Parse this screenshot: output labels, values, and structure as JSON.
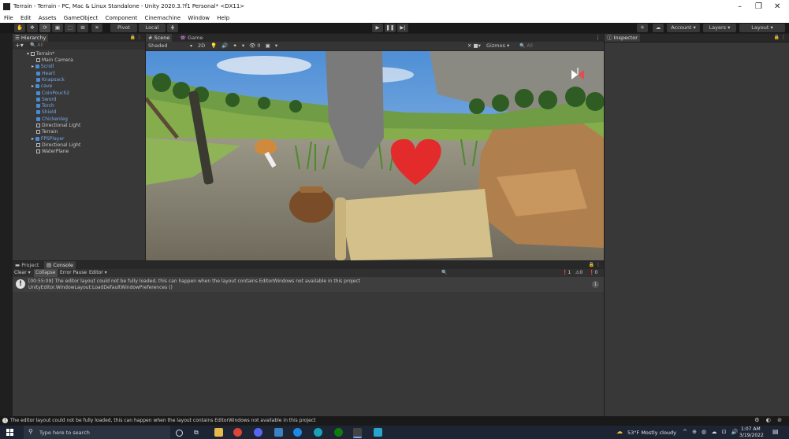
{
  "window": {
    "title": "Terrain - Terrain - PC, Mac & Linux Standalone - Unity 2020.3.?f1 Personal* <DX11>",
    "minimize": "–",
    "maximize": "❐",
    "close": "✕"
  },
  "menu": [
    "File",
    "Edit",
    "Assets",
    "GameObject",
    "Component",
    "Cinemachine",
    "Window",
    "Help"
  ],
  "toolbar": {
    "pivot_label": "Pivot",
    "local_label": "Local",
    "account_label": "Account",
    "layers_label": "Layers",
    "layout_label": "Layout"
  },
  "hierarchy": {
    "tab_label": "Hierarchy",
    "search_placeholder": "All",
    "scene_name": "Terrain*",
    "items": [
      {
        "label": "Main Camera",
        "type": "gray"
      },
      {
        "label": "Scroll",
        "type": "blue",
        "expand": true
      },
      {
        "label": "Heart",
        "type": "blue"
      },
      {
        "label": "Knapsack",
        "type": "blue"
      },
      {
        "label": "cave",
        "type": "blue",
        "expand": true
      },
      {
        "label": "CoinPouch2",
        "type": "blue"
      },
      {
        "label": "Sword",
        "type": "blue"
      },
      {
        "label": "Torch",
        "type": "blue"
      },
      {
        "label": "Shield",
        "type": "blue"
      },
      {
        "label": "Chickenleg",
        "type": "blue"
      },
      {
        "label": "Directional Light",
        "type": "gray"
      },
      {
        "label": "Terrain",
        "type": "gray"
      },
      {
        "label": "FPSPlayer",
        "type": "blue",
        "expand": true
      },
      {
        "label": "Directional Light",
        "type": "gray"
      },
      {
        "label": "WaterPlane",
        "type": "gray"
      }
    ]
  },
  "scene": {
    "tab_scene": "Scene",
    "tab_game": "Game",
    "shading_mode": "Shaded",
    "mode_2d": "2D",
    "gizmos_label": "Gizmos",
    "search_placeholder": "All"
  },
  "inspector": {
    "tab_label": "Inspector"
  },
  "bottom": {
    "tab_project": "Project",
    "tab_console": "Console",
    "clear": "Clear",
    "collapse": "Collapse",
    "error_pause": "Error Pause",
    "editor": "Editor",
    "count_info": "1",
    "count_warn": "0",
    "count_err": "0",
    "log_line1": "[00:55:09] The editor layout could not be fully loaded, this can happen when the layout contains EditorWindows not available in this project",
    "log_line2": "UnityEditor.WindowLayout:LoadDefaultWindowPreferences ()",
    "log_count": "1"
  },
  "status": {
    "message": "The editor layout could not be fully loaded, this can happen when the layout contains EditorWindows not available in this project"
  },
  "taskbar": {
    "search_placeholder": "Type here to search",
    "weather": "53°F  Mostly cloudy",
    "time": "1:07 AM",
    "date": "3/19/2022"
  },
  "colors": {
    "accent_blue": "#4a8ad6",
    "panel_bg": "#383838",
    "taskbar_bg": "#1d2433"
  }
}
